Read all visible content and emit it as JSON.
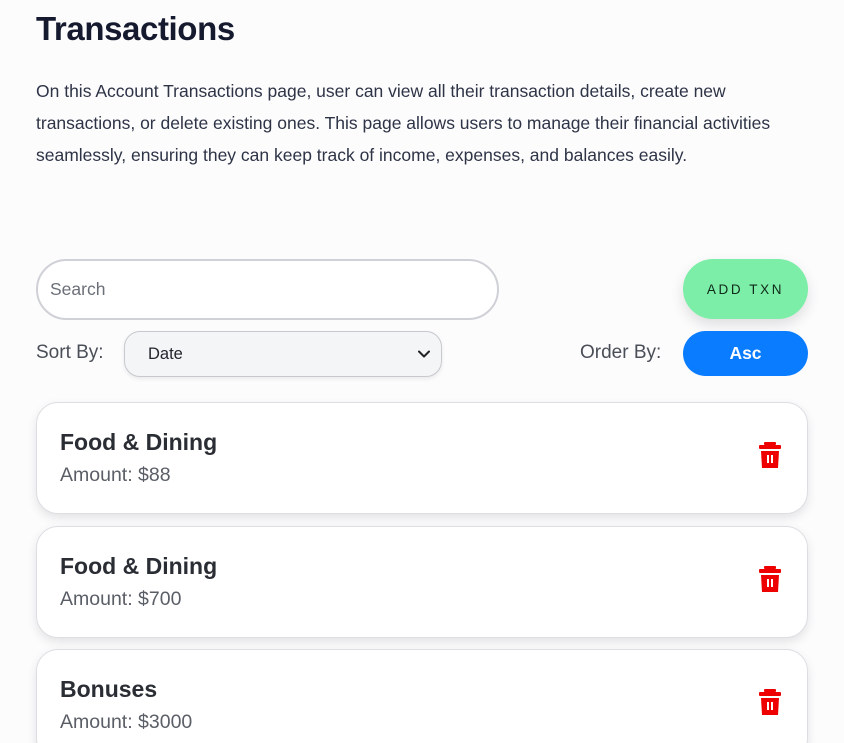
{
  "page": {
    "title": "Transactions",
    "description": "On this Account Transactions page, user can view all their transaction details, create new transactions, or delete existing ones. This page allows users to manage their financial activities seamlessly, ensuring they can keep track of income, expenses, and balances easily."
  },
  "search": {
    "placeholder": "Search",
    "value": ""
  },
  "add_button": {
    "label": "ADD TXN"
  },
  "sort": {
    "label": "Sort By:",
    "selected": "Date"
  },
  "order": {
    "label": "Order By:",
    "value": "Asc"
  },
  "transactions": [
    {
      "category": "Food & Dining",
      "amount": "Amount: $88"
    },
    {
      "category": "Food & Dining",
      "amount": "Amount: $700"
    },
    {
      "category": "Bonuses",
      "amount": "Amount: $3000"
    }
  ],
  "colors": {
    "add_button_bg": "#7ceea7",
    "order_button_bg": "#0a7cff",
    "delete_icon": "#ee0000"
  },
  "icons": {
    "delete": "trash-icon",
    "dropdown": "chevron-down-icon"
  }
}
